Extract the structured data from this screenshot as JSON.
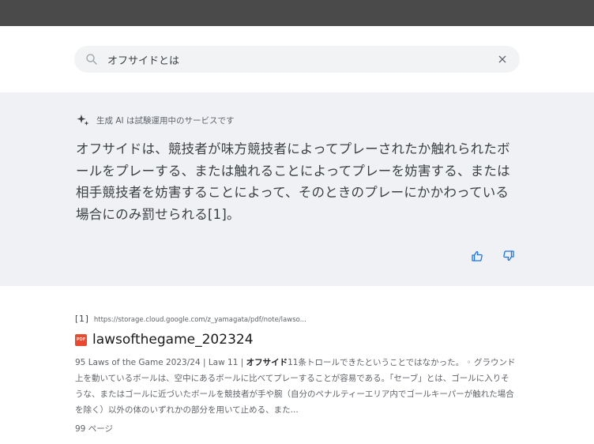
{
  "search": {
    "query": "オフサイドとは"
  },
  "ai": {
    "notice": "生成 AI は試験運用中のサービスです",
    "answer": "オフサイドは、競技者が味方競技者によってプレーされたか触れられたボールをプレーする、または触れることによってプレーを妨害する、または相手競技者を妨害することによって、そのときのプレーにかかわっている場合にのみ罰せられる[1]。"
  },
  "result": {
    "citation_number": "[1]",
    "url": "https://storage.cloud.google.com/z_yamagata/pdf/note/lawso...",
    "file_badge": "PDF",
    "title": "lawsofthegame_202324",
    "snippet_before": "95 Laws of the Game 2023/24 | Law 11 | ",
    "snippet_bold": "オフサイド",
    "snippet_after": "11条トロールできたということではなかった。 ◦ グラウンド上を動いているボールは、空中にあるボールに比べてプレーすることが容易である。「セーブ」とは、ゴールに入りそうな、またはゴールに近づいたボールを競技者が手や腕（自分のペナルティーエリア内でゴールキーパーが触れた場合を除く）以外の体のいずれかの部分を用いて止める、また...",
    "pages": "99 ページ"
  },
  "colors": {
    "topbar": "#4a4a4a",
    "ai_panel": "#eff1f5",
    "pdf_badge": "#e8492f"
  }
}
